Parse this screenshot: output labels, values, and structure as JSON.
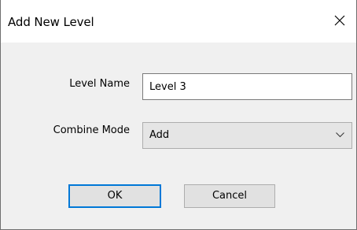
{
  "dialog": {
    "title": "Add New Level",
    "close_icon": "close-icon"
  },
  "form": {
    "level_name_label": "Level Name",
    "level_name_value": "Level 3",
    "combine_mode_label": "Combine Mode",
    "combine_mode_value": "Add",
    "combine_mode_icon": "chevron-down-icon"
  },
  "buttons": {
    "ok_label": "OK",
    "cancel_label": "Cancel"
  },
  "colors": {
    "accent": "#0078d7",
    "dialog_background": "#f0f0f0",
    "titlebar_background": "#ffffff"
  }
}
